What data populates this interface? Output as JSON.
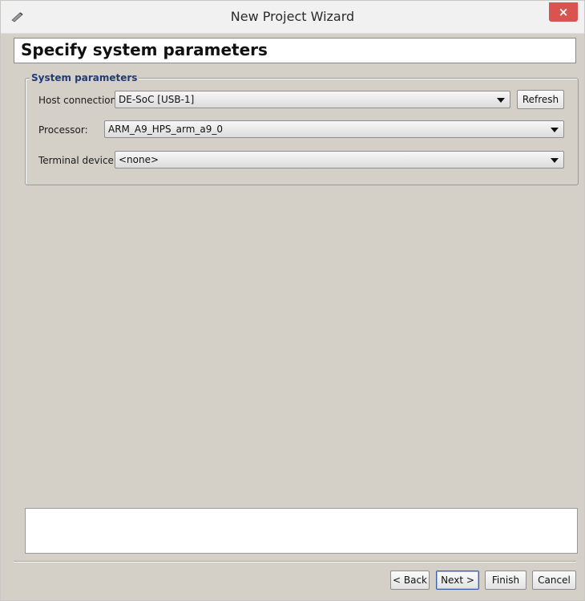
{
  "window": {
    "title": "New Project Wizard",
    "close_glyph": "×",
    "app_icon": "wizard-wand-icon",
    "close_color": "#d9534f"
  },
  "header": {
    "title": "Specify system parameters"
  },
  "system_parameters": {
    "legend": "System parameters",
    "host_connection": {
      "label": "Host connection:",
      "value": "DE-SoC [USB-1]",
      "refresh_label": "Refresh"
    },
    "processor": {
      "label": "Processor:",
      "value": "ARM_A9_HPS_arm_a9_0"
    },
    "terminal_device": {
      "label": "Terminal device:",
      "value": "<none>"
    }
  },
  "message": {
    "text": ""
  },
  "footer": {
    "back_label": "< Back",
    "next_label": "Next >",
    "finish_label": "Finish",
    "cancel_label": "Cancel"
  },
  "colors": {
    "dialog_bg": "#d4d0c8",
    "legend_text": "#1f3b7a"
  }
}
